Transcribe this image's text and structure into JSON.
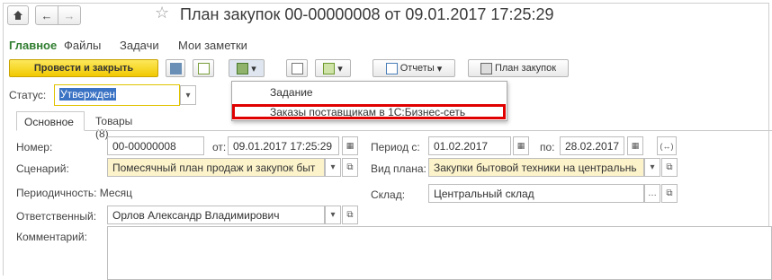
{
  "window": {
    "title": "План закупок 00-00000008 от 09.01.2017 17:25:29"
  },
  "nav": {
    "home_icon": "home-icon",
    "back": "←",
    "forward": "→",
    "star": "☆"
  },
  "sections": [
    "Главное",
    "Файлы",
    "Задачи",
    "Мои заметки"
  ],
  "toolbar": {
    "post_close": "Провести и закрыть",
    "reports": "Отчеты",
    "plan": "План закупок",
    "dropdown_arrow": "▾"
  },
  "status": {
    "label": "Статус:",
    "value": "Утвержден"
  },
  "dropdown": {
    "items": [
      "Задание",
      "Заказы поставщикам в 1С:Бизнес-сеть"
    ]
  },
  "tabs": [
    "Основное",
    "Товары (8)"
  ],
  "form": {
    "number_label": "Номер:",
    "number": "00-00000008",
    "from_label": "от:",
    "date": "09.01.2017 17:25:29",
    "period_label": "Период с:",
    "period_from": "01.02.2017",
    "to_label": "по:",
    "period_to": "28.02.2017",
    "scenario_label": "Сценарий:",
    "scenario": "Помесячный план продаж и закупок быт",
    "plan_type_label": "Вид плана:",
    "plan_type": "Закупки бытовой техники на центральнь",
    "periodicity": "Периодичность: Месяц",
    "warehouse_label": "Склад:",
    "warehouse": "Центральный склад",
    "responsible_label": "Ответственный:",
    "responsible": "Орлов Александр Владимирович",
    "comment_label": "Комментарий:"
  },
  "colors": {
    "accent_green": "#3a8a3a",
    "highlight_red": "#e00000",
    "field_yellow": "#fcf3cb"
  }
}
